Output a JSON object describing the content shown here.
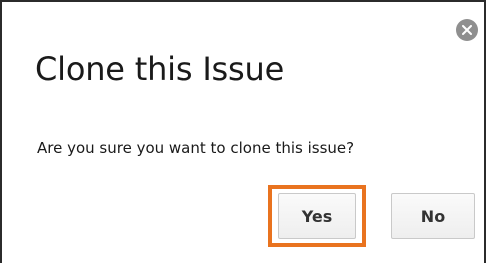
{
  "dialog": {
    "title": "Clone this Issue",
    "message": "Are you sure you want to clone this issue?",
    "close_icon": "close-x-icon",
    "buttons": {
      "yes_label": "Yes",
      "no_label": "No"
    },
    "highlight_color": "#e9731f"
  }
}
